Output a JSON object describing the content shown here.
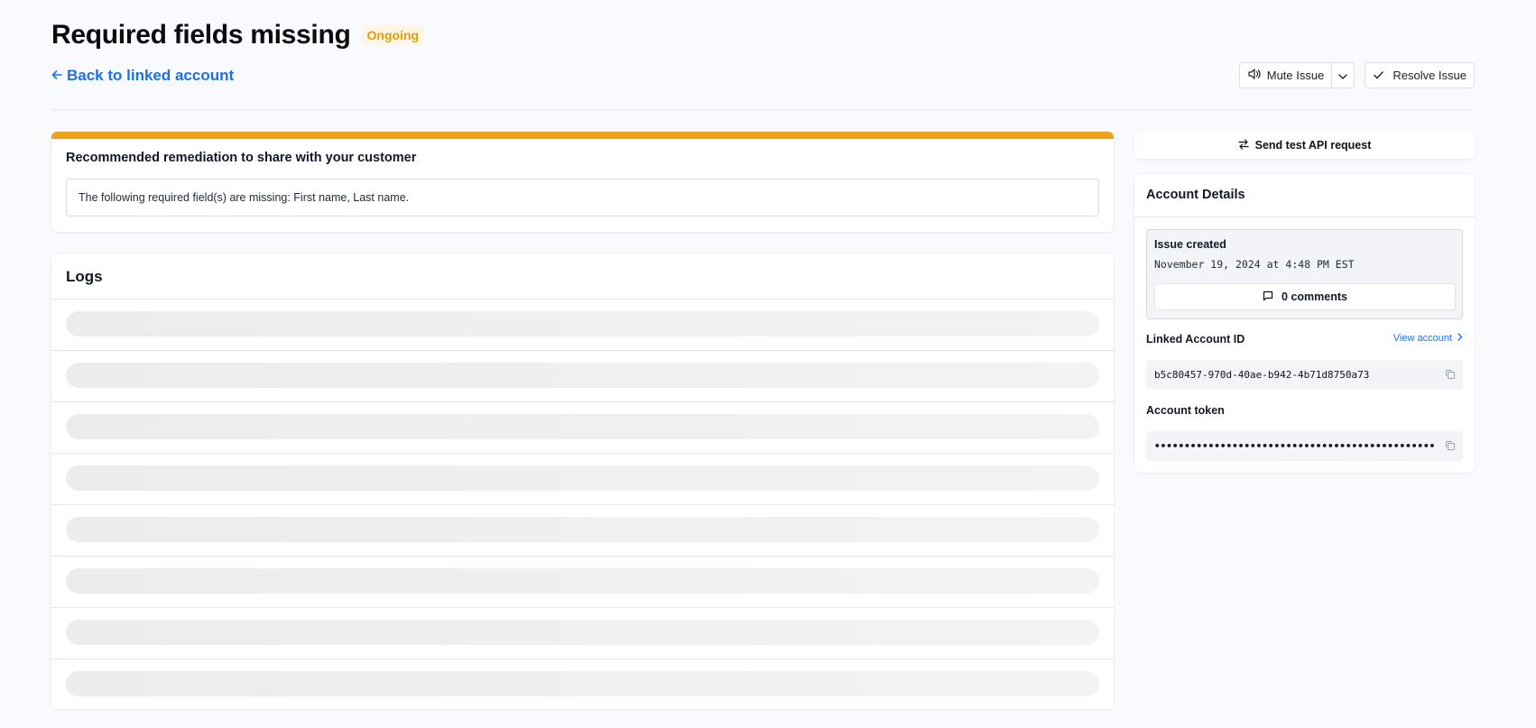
{
  "header": {
    "title": "Required fields missing",
    "status": "Ongoing",
    "back_link": "Back to linked account"
  },
  "actions": {
    "mute_label": "Mute Issue",
    "resolve_label": "Resolve Issue"
  },
  "remediation": {
    "heading": "Recommended remediation to share with your customer",
    "message": "The following required field(s) are missing: First name, Last name."
  },
  "logs": {
    "heading": "Logs"
  },
  "sidebar": {
    "send_test_label": "Send test API request",
    "account_details_heading": "Account Details",
    "issue_created_label": "Issue created",
    "issue_created_value": "November 19, 2024 at 4:48 PM EST",
    "comments_label": "0 comments",
    "linked_account_id_label": "Linked Account ID",
    "view_account_label": "View account",
    "linked_account_id_value": "b5c80457-970d-40ae-b942-4b71d8750a73",
    "account_token_label": "Account token",
    "account_token_value": "••••••••••••••••••••••••••••••••••••••••••••••••••••••••••••"
  },
  "colors": {
    "accent": "#1f6fe5",
    "warning": "#eea216",
    "badge_text": "#e59c07",
    "background": "#f8fafd"
  }
}
